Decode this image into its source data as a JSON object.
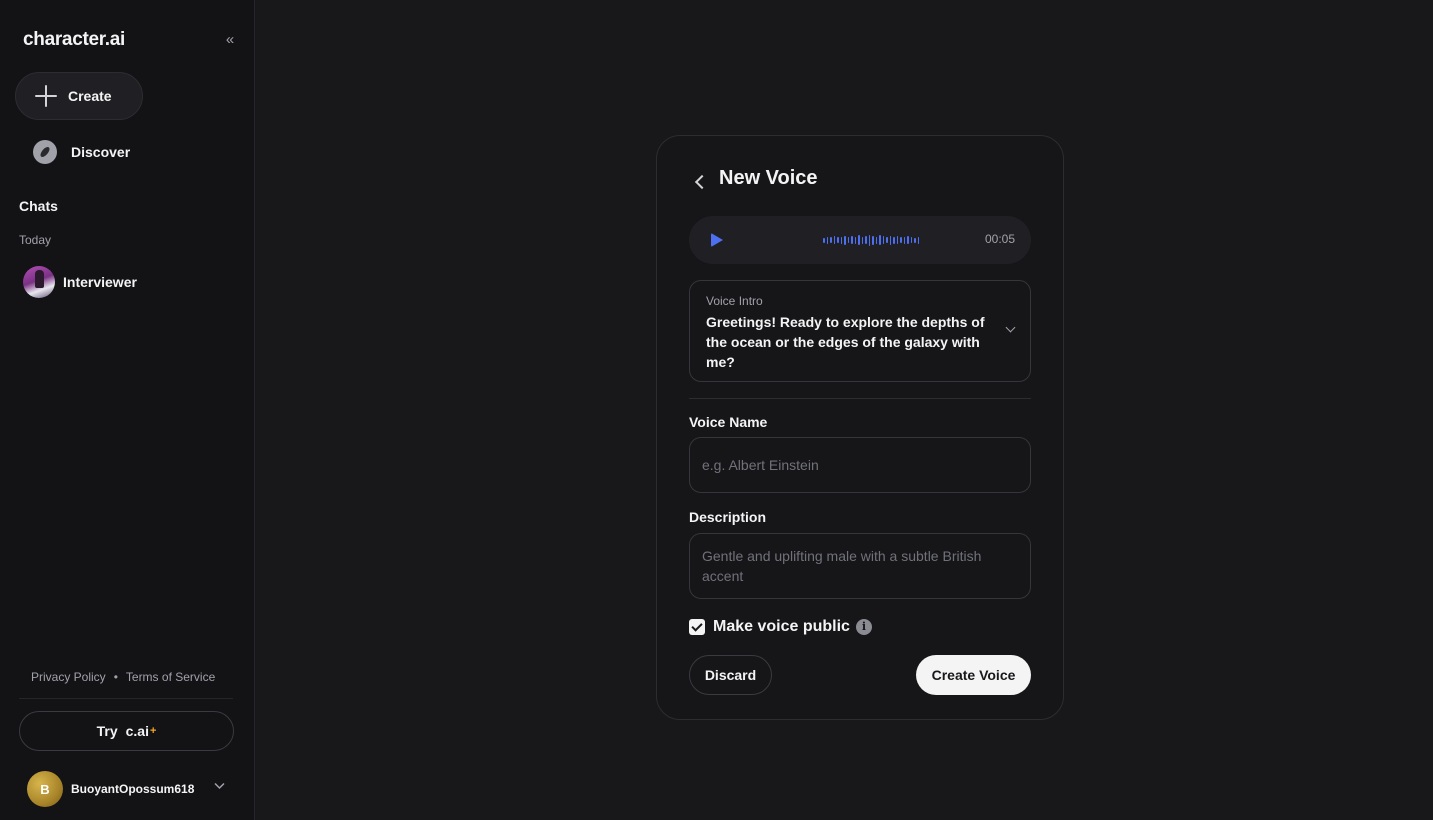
{
  "sidebar": {
    "logo": "character.ai",
    "collapse_icon": "«",
    "create_label": "Create",
    "discover_label": "Discover",
    "chats_heading": "Chats",
    "today_label": "Today",
    "chats": [
      {
        "name": "Interviewer"
      }
    ],
    "footer": {
      "privacy": "Privacy Policy",
      "separator": "•",
      "terms": "Terms of Service"
    },
    "try_label": "Try",
    "try_brand": "c.ai",
    "try_sparkle": "+",
    "user": {
      "initial": "B",
      "name": "BuoyantOpossum618"
    }
  },
  "voice_form": {
    "title": "New Voice",
    "player": {
      "time": "00:05",
      "accent_color": "#4d6ff2"
    },
    "intro": {
      "label": "Voice Intro",
      "text": "Greetings! Ready to explore the depths of the ocean or the edges of the galaxy with me?"
    },
    "voice_name": {
      "label": "Voice Name",
      "value": "",
      "placeholder": "e.g. Albert Einstein"
    },
    "description": {
      "label": "Description",
      "value": "",
      "placeholder": "Gentle and uplifting male with a subtle British accent"
    },
    "public_checkbox": {
      "label": "Make voice public",
      "checked": true
    },
    "info_icon_glyph": "i",
    "discard_label": "Discard",
    "create_label": "Create Voice"
  },
  "icons": {
    "collapse": "double-chevron-left-icon",
    "create": "plus-icon",
    "discover": "compass-icon",
    "back": "chevron-left-icon",
    "play": "play-icon",
    "intro_expand": "chevron-down-icon",
    "info": "info-icon",
    "user_menu": "chevron-down-icon"
  }
}
